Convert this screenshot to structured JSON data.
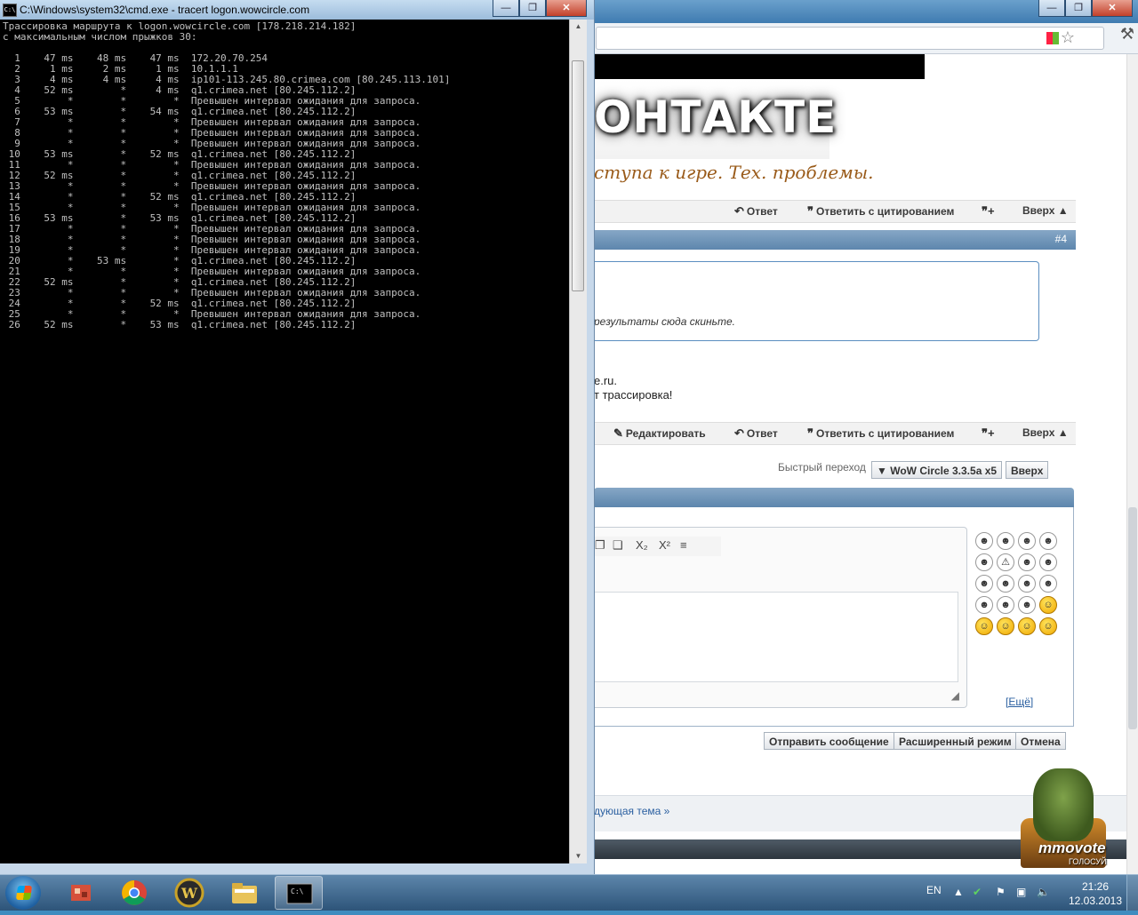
{
  "cmd": {
    "title": "C:\\Windows\\system32\\cmd.exe - tracert  logon.wowcircle.com",
    "icon_text": "C:\\",
    "header_lines": [
      "Трассировка маршрута к logon.wowcircle.com [178.218.214.182]",
      "с максимальным числом прыжков 30:"
    ],
    "hops": [
      {
        "n": "1",
        "t1": "47 ms",
        "t2": "48 ms",
        "t3": "47 ms",
        "host": "172.20.70.254"
      },
      {
        "n": "2",
        "t1": "1 ms",
        "t2": "2 ms",
        "t3": "1 ms",
        "host": "10.1.1.1"
      },
      {
        "n": "3",
        "t1": "4 ms",
        "t2": "4 ms",
        "t3": "4 ms",
        "host": "ip101-113.245.80.crimea.com [80.245.113.101]"
      },
      {
        "n": "4",
        "t1": "52 ms",
        "t2": "*",
        "t3": "4 ms",
        "host": "q1.crimea.net [80.245.112.2]"
      },
      {
        "n": "5",
        "t1": "*",
        "t2": "*",
        "t3": "*",
        "host": "Превышен интервал ожидания для запроса."
      },
      {
        "n": "6",
        "t1": "53 ms",
        "t2": "*",
        "t3": "54 ms",
        "host": "q1.crimea.net [80.245.112.2]"
      },
      {
        "n": "7",
        "t1": "*",
        "t2": "*",
        "t3": "*",
        "host": "Превышен интервал ожидания для запроса."
      },
      {
        "n": "8",
        "t1": "*",
        "t2": "*",
        "t3": "*",
        "host": "Превышен интервал ожидания для запроса."
      },
      {
        "n": "9",
        "t1": "*",
        "t2": "*",
        "t3": "*",
        "host": "Превышен интервал ожидания для запроса."
      },
      {
        "n": "10",
        "t1": "53 ms",
        "t2": "*",
        "t3": "52 ms",
        "host": "q1.crimea.net [80.245.112.2]"
      },
      {
        "n": "11",
        "t1": "*",
        "t2": "*",
        "t3": "*",
        "host": "Превышен интервал ожидания для запроса."
      },
      {
        "n": "12",
        "t1": "52 ms",
        "t2": "*",
        "t3": "*",
        "host": "q1.crimea.net [80.245.112.2]"
      },
      {
        "n": "13",
        "t1": "*",
        "t2": "*",
        "t3": "*",
        "host": "Превышен интервал ожидания для запроса."
      },
      {
        "n": "14",
        "t1": "*",
        "t2": "*",
        "t3": "52 ms",
        "host": "q1.crimea.net [80.245.112.2]"
      },
      {
        "n": "15",
        "t1": "*",
        "t2": "*",
        "t3": "*",
        "host": "Превышен интервал ожидания для запроса."
      },
      {
        "n": "16",
        "t1": "53 ms",
        "t2": "*",
        "t3": "53 ms",
        "host": "q1.crimea.net [80.245.112.2]"
      },
      {
        "n": "17",
        "t1": "*",
        "t2": "*",
        "t3": "*",
        "host": "Превышен интервал ожидания для запроса."
      },
      {
        "n": "18",
        "t1": "*",
        "t2": "*",
        "t3": "*",
        "host": "Превышен интервал ожидания для запроса."
      },
      {
        "n": "19",
        "t1": "*",
        "t2": "*",
        "t3": "*",
        "host": "Превышен интервал ожидания для запроса."
      },
      {
        "n": "20",
        "t1": "*",
        "t2": "53 ms",
        "t3": "*",
        "host": "q1.crimea.net [80.245.112.2]"
      },
      {
        "n": "21",
        "t1": "*",
        "t2": "*",
        "t3": "*",
        "host": "Превышен интервал ожидания для запроса."
      },
      {
        "n": "22",
        "t1": "52 ms",
        "t2": "*",
        "t3": "*",
        "host": "q1.crimea.net [80.245.112.2]"
      },
      {
        "n": "23",
        "t1": "*",
        "t2": "*",
        "t3": "*",
        "host": "Превышен интервал ожидания для запроса."
      },
      {
        "n": "24",
        "t1": "*",
        "t2": "*",
        "t3": "52 ms",
        "host": "q1.crimea.net [80.245.112.2]"
      },
      {
        "n": "25",
        "t1": "*",
        "t2": "*",
        "t3": "*",
        "host": "Превышен интервал ожидания для запроса."
      },
      {
        "n": "26",
        "t1": "52 ms",
        "t2": "*",
        "t3": "53 ms",
        "host": "q1.crimea.net [80.245.112.2]"
      }
    ]
  },
  "browser": {
    "banner": {
      "logo_text": "ОНТАКТЕ",
      "subtitle": "ступа к игре. Тех. проблемы."
    },
    "post_actions_top": {
      "reply": "Ответ",
      "quote": "Ответить с цитированием",
      "top": "Вверх"
    },
    "post_number": "#4",
    "quote_text": "результаты сюда скиньте.",
    "post_lines": [
      "e.ru.",
      "т трассировка!"
    ],
    "post_actions_bottom": {
      "edit": "Редактировать",
      "reply": "Ответ",
      "quote": "Ответить с цитированием",
      "top": "Вверх"
    },
    "quick_nav": {
      "label": "Быстрый переход",
      "selected": "WoW Circle 3.3.5a x5",
      "top": "Вверх"
    },
    "more_smilies": "[Ещё]",
    "buttons": {
      "send": "Отправить сообщение",
      "advanced": "Расширенный режим",
      "cancel": "Отмена"
    },
    "next_topic": "дующая тема »",
    "mmovote": {
      "brand": "mmovote",
      "sub": "ГОЛОСУЙ"
    }
  },
  "taskbar": {
    "lang": "EN",
    "time": "21:26",
    "date": "12.03.2013"
  }
}
